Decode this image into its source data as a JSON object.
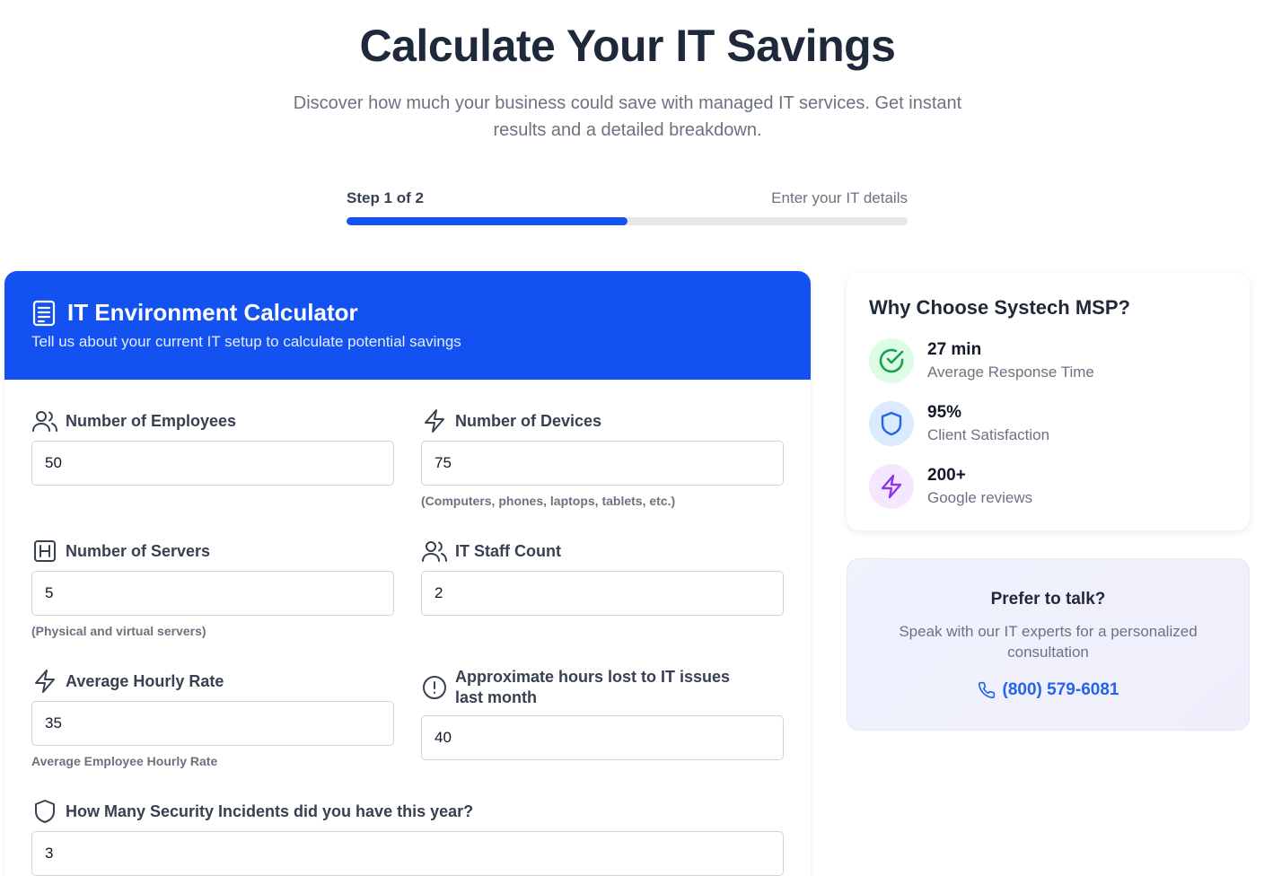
{
  "hero": {
    "title": "Calculate Your IT Savings",
    "subtitle": "Discover how much your business could save with managed IT services. Get instant results and a detailed breakdown."
  },
  "progress": {
    "step_label": "Step 1 of 2",
    "note": "Enter your IT details",
    "percent": 50
  },
  "calculator": {
    "title": "IT Environment Calculator",
    "description": "Tell us about your current IT setup to calculate potential savings",
    "fields": {
      "employees": {
        "label": "Number of Employees",
        "value": "50",
        "icon": "users-icon"
      },
      "devices": {
        "label": "Number of Devices",
        "value": "75",
        "hint": "(Computers, phones, laptops, tablets, etc.)",
        "icon": "lightning-icon"
      },
      "servers": {
        "label": "Number of Servers",
        "value": "5",
        "hint": "(Physical and virtual servers)",
        "icon": "server-icon"
      },
      "it_staff": {
        "label": "IT Staff Count",
        "value": "2",
        "icon": "users-icon"
      },
      "hourly_rate": {
        "label": "Average Hourly Rate",
        "value": "35",
        "hint": "Average Employee Hourly Rate",
        "icon": "lightning-icon"
      },
      "hours_lost": {
        "label": "Approximate hours lost to IT issues last month",
        "value": "40",
        "icon": "alert-circle-icon"
      },
      "incidents": {
        "label": "How Many Security Incidents did you have this year?",
        "value": "3",
        "icon": "shield-icon"
      }
    }
  },
  "why": {
    "title": "Why Choose Systech MSP?",
    "stats": [
      {
        "value": "27 min",
        "label": "Average Response Time",
        "icon": "check-circle-icon",
        "color": "#16a34a",
        "bg": "#dcfce7"
      },
      {
        "value": "95%",
        "label": "Client Satisfaction",
        "icon": "shield-icon",
        "color": "#2563eb",
        "bg": "#dbeafe"
      },
      {
        "value": "200+",
        "label": "Google reviews",
        "icon": "lightning-icon",
        "color": "#9333ea",
        "bg": "#f3e8ff"
      }
    ]
  },
  "talk": {
    "title": "Prefer to talk?",
    "description": "Speak with our IT experts for a personalized consultation",
    "phone": "(800) 579-6081",
    "icon": "phone-icon"
  },
  "colors": {
    "primary": "#1352f1",
    "link": "#2563eb"
  }
}
